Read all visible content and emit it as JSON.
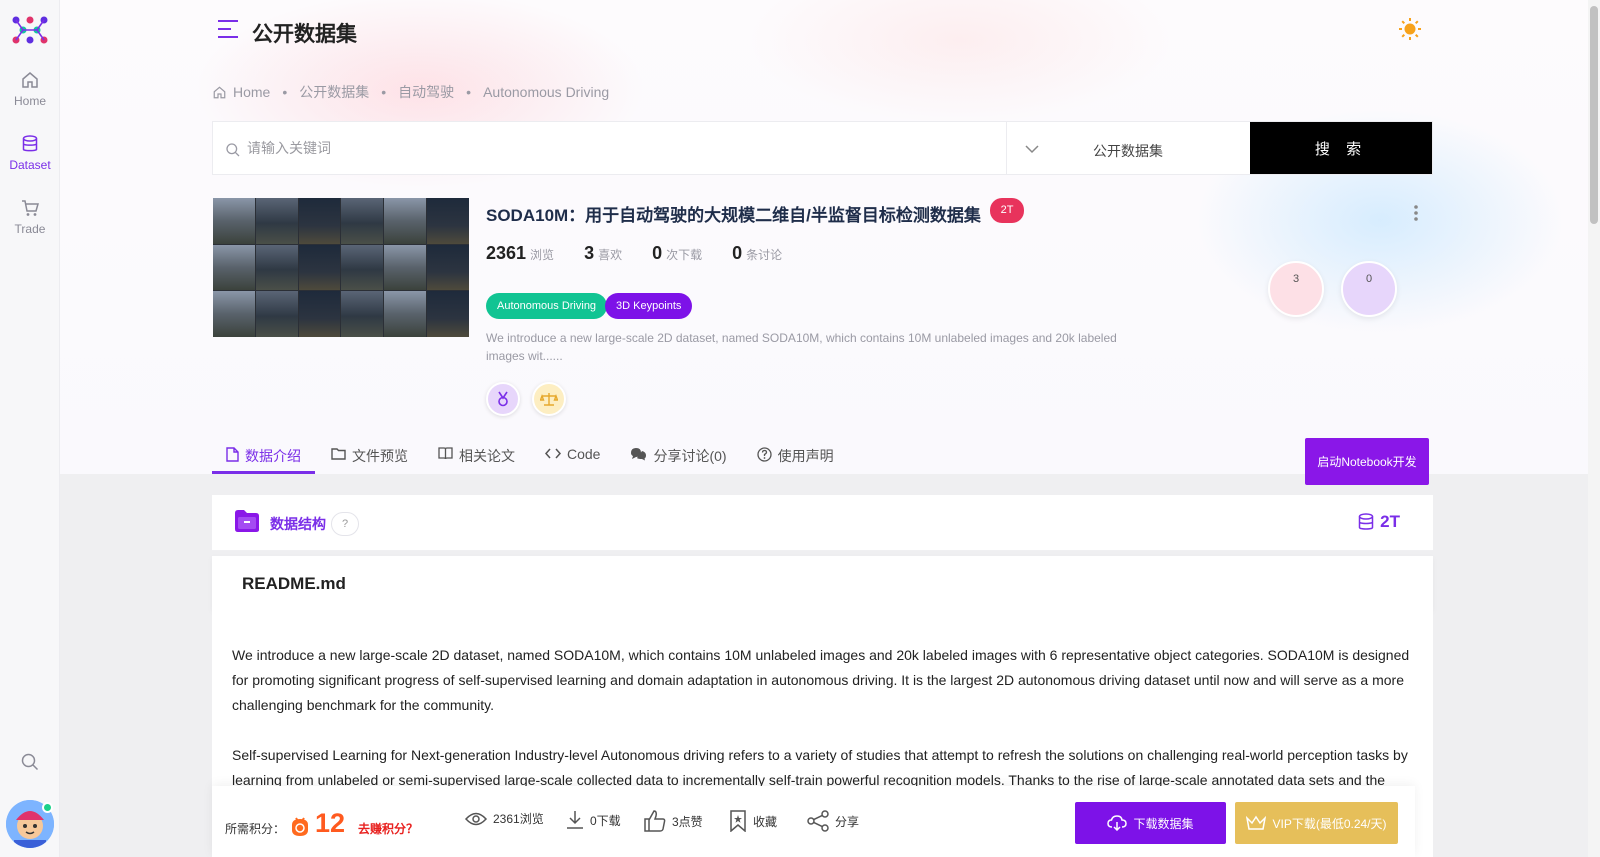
{
  "sidebar": {
    "items": [
      {
        "label": "Home",
        "icon": "home-icon"
      },
      {
        "label": "Dataset",
        "icon": "database-icon",
        "active": true
      },
      {
        "label": "Trade",
        "icon": "cart-icon"
      }
    ]
  },
  "header": {
    "title": "公开数据集"
  },
  "breadcrumb": [
    "Home",
    "公开数据集",
    "自动驾驶",
    "Autonomous Driving"
  ],
  "search": {
    "placeholder": "请输入关键词",
    "category": "公开数据集",
    "button": "搜 索"
  },
  "dataset": {
    "title": "SODA10M：用于自动驾驶的大规模二维自/半监督目标检测数据集",
    "size_badge": "2T",
    "stats": [
      {
        "value": "2361",
        "unit": "浏览"
      },
      {
        "value": "3",
        "unit": "喜欢"
      },
      {
        "value": "0",
        "unit": "次下载"
      },
      {
        "value": "0",
        "unit": "条讨论"
      }
    ],
    "tags": [
      {
        "label": "Autonomous Driving",
        "color": "#11c493"
      },
      {
        "label": "3D Keypoints",
        "color": "#7d12e8"
      }
    ],
    "description": "We introduce a new large-scale 2D dataset, named SODA10M, which contains 10M unlabeled images and 20k labeled images wit......",
    "bubbles": [
      {
        "value": "3",
        "color": "#fde0e6"
      },
      {
        "value": "0",
        "color": "#e7d6fb"
      }
    ]
  },
  "tabs": [
    {
      "label": "数据介绍",
      "icon": "file-icon",
      "active": true
    },
    {
      "label": "文件预览",
      "icon": "folder-icon"
    },
    {
      "label": "相关论文",
      "icon": "book-icon"
    },
    {
      "label": "Code",
      "icon": "code-icon"
    },
    {
      "label": "分享讨论(0)",
      "icon": "comments-icon"
    },
    {
      "label": "使用声明",
      "icon": "question-icon"
    }
  ],
  "notebook_button": "启动Notebook开发",
  "data_structure": {
    "label": "数据结构",
    "help": "?",
    "size": "2T"
  },
  "readme": {
    "filename": "README.md",
    "paragraphs": [
      " We introduce a new large-scale 2D dataset, named SODA10M, which contains 10M unlabeled images and 20k labeled images with 6 representative object categories. SODA10M is designed for promoting significant progress of self-supervised learning and domain adaptation in autonomous driving. It is the largest 2D autonomous driving dataset until now and will serve as a more challenging benchmark for the community.",
      "Self-supervised Learning for Next-generation Industry-level Autonomous driving refers to a variety of studies that attempt to refresh the solutions on challenging real-world perception tasks by learning from unlabeled or semi-supervised large-scale collected data to incrementally self-train powerful recognition models. Thanks to the rise of large-scale annotated data sets and the"
    ]
  },
  "bottom_bar": {
    "cost_label": "所需积分：",
    "cost_value": "12",
    "earn_link": "去赚积分？",
    "actions": [
      {
        "label": "2361浏览",
        "icon": "eye-icon"
      },
      {
        "label": "0下载",
        "icon": "download-icon"
      },
      {
        "label": "3点赞",
        "icon": "thumbs-up-icon"
      },
      {
        "label": "收藏",
        "icon": "bookmark-icon"
      },
      {
        "label": "分享",
        "icon": "share-icon"
      }
    ],
    "download_button": "下载数据集",
    "vip_button": "VIP下载(最低0.24/天)"
  },
  "colors": {
    "accent": "#7a2ee8",
    "primary_button": "#7d12e8",
    "vip": "#e6bf5a",
    "badge": "#e8335c",
    "cost": "#ff5a1f"
  }
}
